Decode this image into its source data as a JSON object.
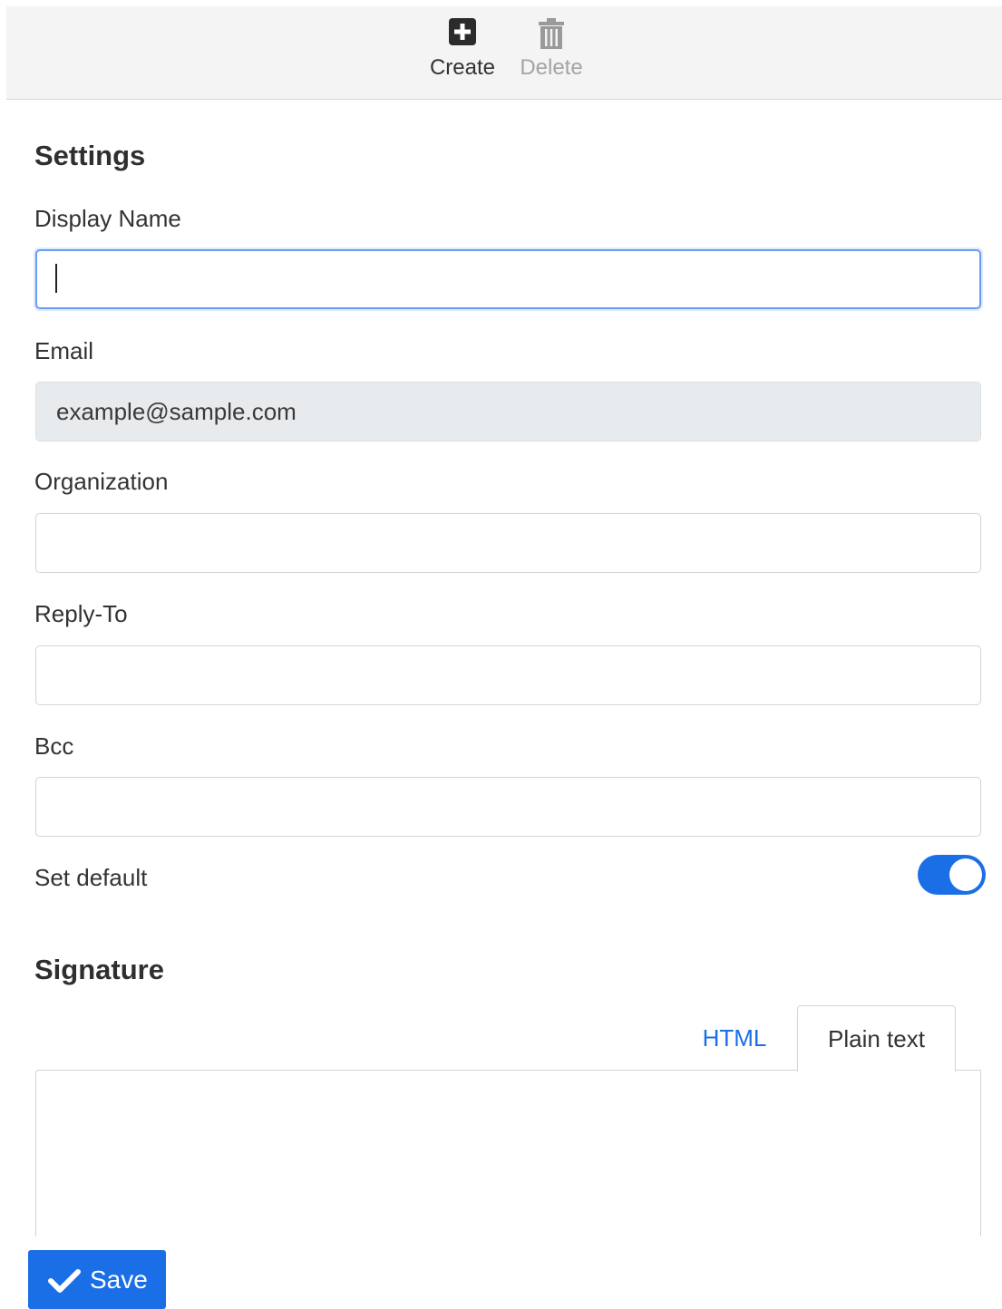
{
  "toolbar": {
    "create_label": "Create",
    "create_icon": "plus-square-icon",
    "delete_label": "Delete",
    "delete_icon": "trash-icon"
  },
  "settings": {
    "title": "Settings",
    "display_name": {
      "label": "Display Name",
      "value": "",
      "placeholder": ""
    },
    "email": {
      "label": "Email",
      "value": "example@sample.com"
    },
    "organization": {
      "label": "Organization",
      "value": ""
    },
    "reply_to": {
      "label": "Reply-To",
      "value": ""
    },
    "bcc": {
      "label": "Bcc",
      "value": ""
    },
    "set_default": {
      "label": "Set default",
      "checked": true
    }
  },
  "signature": {
    "title": "Signature",
    "tabs": [
      {
        "label": "HTML",
        "active": false
      },
      {
        "label": "Plain text",
        "active": true
      }
    ],
    "content": ""
  },
  "footer": {
    "save_label": "Save",
    "save_icon": "checkmark-icon"
  },
  "colors": {
    "accent": "#1a6fe6",
    "toolbar_bg": "#f4f4f4",
    "readonly_bg": "#e8ebee",
    "disabled_text": "#a4a4a4"
  }
}
